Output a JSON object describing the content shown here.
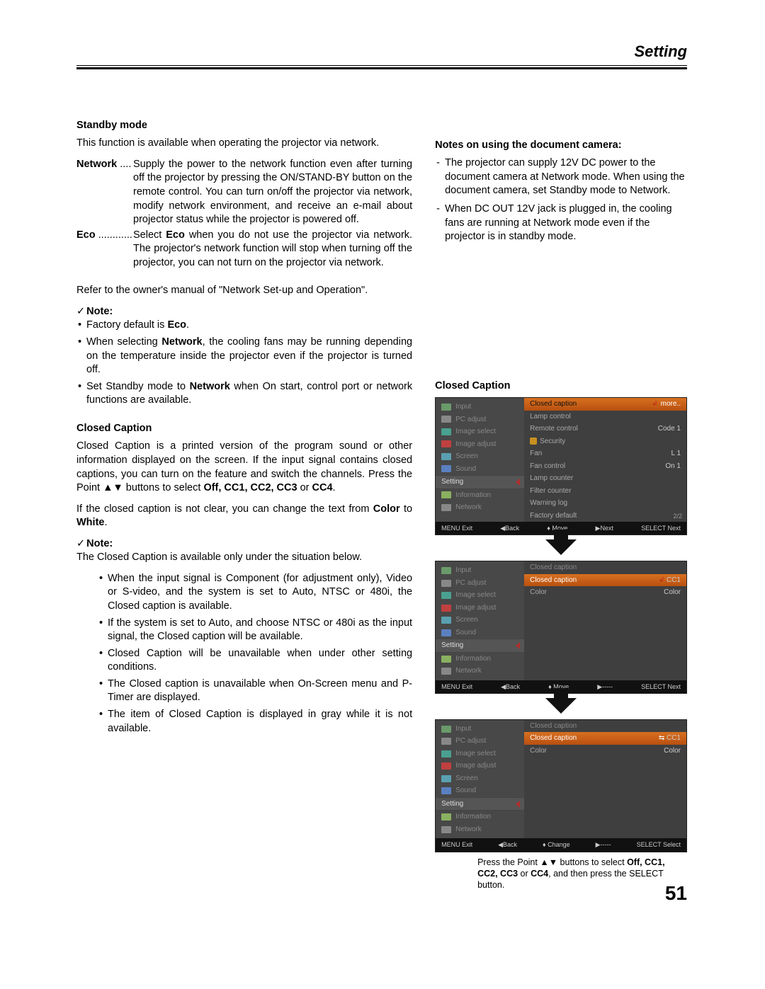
{
  "header": {
    "title": "Setting",
    "page_number": "51"
  },
  "left": {
    "standby": {
      "heading": "Standby mode",
      "intro": "This function is available when operating the projector via network.",
      "defs": [
        {
          "term": "Network",
          "dots": " ....",
          "body": "Supply the power to the network function even after turning off the projector by pressing the ON/STAND-BY button on the remote control. You can turn on/off the projector via network, modify network environment, and receive an e-mail about projector status while the projector is powered off."
        },
        {
          "term": "Eco",
          "dots": " ............",
          "body_pre": "Select ",
          "body_bold": "Eco",
          "body_post": " when you do not use the projector via network. The projector's network function will stop when turning off the projector, you can not turn on the projector via network."
        }
      ],
      "refer": "Refer to the owner's manual of \"Network Set-up and Operation\".",
      "note_label": "Note:",
      "note_items": [
        {
          "pre": "Factory default is ",
          "b1": "Eco",
          "post": "."
        },
        {
          "pre": "When selecting ",
          "b1": "Network",
          "post": ", the cooling fans may be running depending on the temperature inside the projector even if  the projector is turned off."
        },
        {
          "pre": "Set Standby mode to ",
          "b1": "Network",
          "post": " when On start, control port or network functions are available."
        }
      ]
    },
    "cc": {
      "heading": "Closed Caption",
      "para1_a": "Closed Caption is a printed version of the program sound or other information displayed on the screen. If the input signal contains closed captions, you can turn on the feature and switch the channels. Press the Point ▲▼ buttons to select ",
      "para1_b_bold": "Off, CC1, CC2, CC3 ",
      "para1_or": "or ",
      "para1_cc4": "CC4",
      "para1_end": ".",
      "para2_a": "If the closed caption is not clear, you can change the text from ",
      "para2_b": "Color",
      "para2_to": " to ",
      "para2_c": "White",
      "para2_end": ".",
      "note_label": "Note:",
      "note_intro": "The Closed Caption is available only under the situation below.",
      "bullets": [
        "When the input signal is Component (for adjustment only),  Video or  S-video, and the system is set to Auto, NTSC or 480i, the Closed caption is available.",
        "If  the system is set to Auto, and choose NTSC or 480i as the input signal, the Closed caption will be available.",
        "Closed Caption will be unavailable when under other setting conditions.",
        "The Closed caption is unavailable when On-Screen menu and P-Timer are displayed.",
        "The item of Closed Caption is displayed in gray while it is not available."
      ]
    }
  },
  "right": {
    "notes_heading": "Notes on using the document camera:",
    "notes": [
      "The projector can supply 12V DC power to the document camera at Network mode. When using the document camera, set Standby mode to Network.",
      "When DC OUT 12V jack is plugged in, the cooling fans are running at Network mode even if the projector is in standby mode."
    ],
    "cc_heading": "Closed Caption",
    "menu_left": [
      {
        "label": "Input",
        "ico": "green"
      },
      {
        "label": "PC adjust",
        "ico": "gray"
      },
      {
        "label": "Image select",
        "ico": "teal"
      },
      {
        "label": "Image adjust",
        "ico": "red"
      },
      {
        "label": "Screen",
        "ico": "cyan"
      },
      {
        "label": "Sound",
        "ico": "blue"
      },
      {
        "label": "Setting",
        "ico": "orange",
        "selected": true
      },
      {
        "label": "Information",
        "ico": "lime"
      },
      {
        "label": "Network",
        "ico": "gray"
      }
    ],
    "panel1_right": [
      {
        "l": "Closed caption",
        "r": "more..",
        "hl": true,
        "more": true
      },
      {
        "l": "Lamp control",
        "r": ""
      },
      {
        "l": "Remote control",
        "r": "Code 1"
      },
      {
        "l": "Security",
        "r": "",
        "lock": true
      },
      {
        "l": "Fan",
        "r": "L 1"
      },
      {
        "l": "Fan control",
        "r": "On 1"
      },
      {
        "l": "Lamp counter",
        "r": ""
      },
      {
        "l": "Filter counter",
        "r": ""
      },
      {
        "l": "Warning log",
        "r": ""
      },
      {
        "l": "Factory default",
        "r": ""
      }
    ],
    "panel1_pager": "2/2",
    "footer1": {
      "a": "MENU Exit",
      "b": "◀Back",
      "c": "♦ Move",
      "d": "▶Next",
      "e": "SELECT Next"
    },
    "panel2_right_top": {
      "l": "Closed caption",
      "r": ""
    },
    "panel2_right_rows": [
      {
        "l": "Closed caption",
        "r": "CC1",
        "hl": true,
        "retIcon": true
      },
      {
        "l": "Color",
        "r": "Color"
      }
    ],
    "footer2": {
      "a": "MENU Exit",
      "b": "◀Back",
      "c": "♦ Move",
      "d": "▶-----",
      "e": "SELECT Next"
    },
    "panel3_right_top": {
      "l": "Closed caption",
      "r": ""
    },
    "panel3_right_rows": [
      {
        "l": "Closed caption",
        "r": "CC1",
        "hl": true,
        "chevIcon": true
      },
      {
        "l": "Color",
        "r": "Color"
      }
    ],
    "footer3": {
      "a": "MENU Exit",
      "b": "◀Back",
      "c": "♦ Change",
      "d": "▶-----",
      "e": "SELECT Select"
    },
    "caption_a": "Press the Point ▲▼ buttons to select ",
    "caption_b": "Off, CC1, CC2, CC3 ",
    "caption_or": "or ",
    "caption_cc4": "CC4",
    "caption_end": ", and then press the SELECT button."
  }
}
